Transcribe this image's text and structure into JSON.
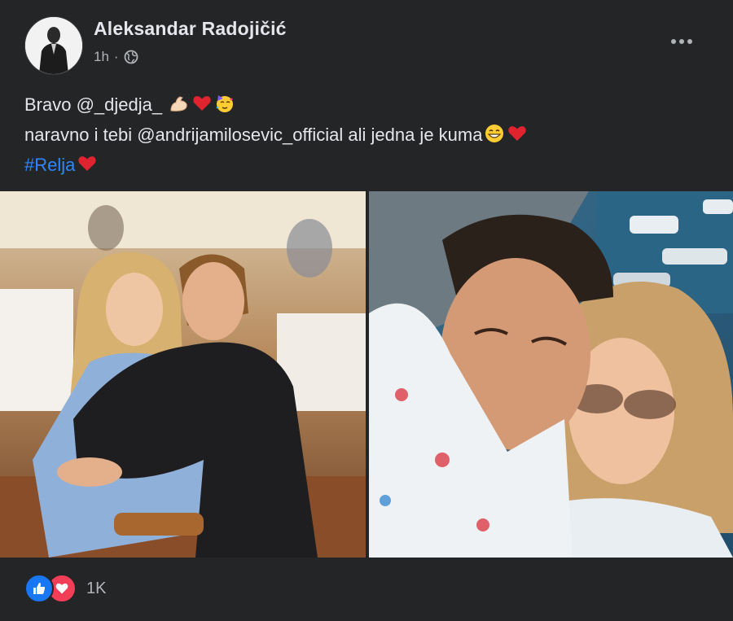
{
  "post": {
    "author": "Aleksandar Radojičić",
    "time": "1h",
    "separator": "·",
    "audience_icon": "globe-icon",
    "more_icon": "more-horizontal-icon"
  },
  "text": {
    "line1_prefix": "Bravo ",
    "line1_mention": "@_djedja_",
    "line1_emojis": [
      "flexed-biceps",
      "red-heart",
      "partying-face"
    ],
    "line2_prefix": "naravno i tebi ",
    "line2_mention": "@andrijamilosevic_official",
    "line2_suffix": " ali jedna je kuma",
    "line2_emojis": [
      "grinning-face",
      "red-heart"
    ],
    "hashtag": "#Relja",
    "hashtag_emoji": "red-heart"
  },
  "reactions": {
    "icons": [
      "like-icon",
      "love-icon"
    ],
    "count": "1K"
  },
  "colors": {
    "background": "#242526",
    "text": "#e4e6eb",
    "secondary": "#b0b3b8",
    "link": "#2d88ff",
    "like": "#1877f2",
    "love": "#f33e58"
  }
}
